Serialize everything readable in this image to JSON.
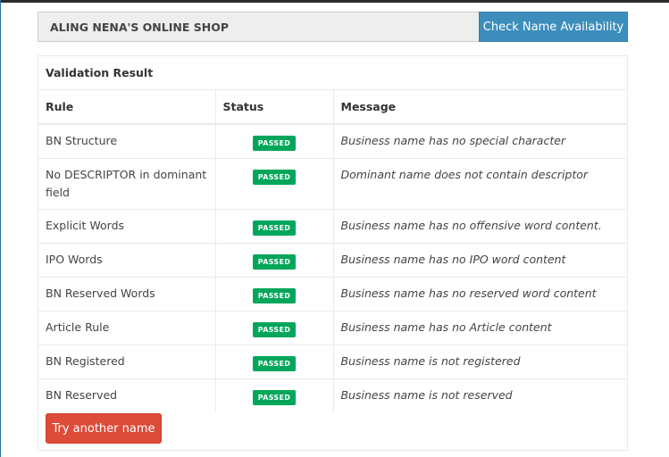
{
  "search": {
    "business_name": "ALING NENA'S ONLINE SHOP",
    "check_button": "Check Name Availability"
  },
  "result": {
    "title": "Validation Result",
    "columns": [
      "Rule",
      "Status",
      "Message"
    ],
    "rows": [
      {
        "rule": "BN Structure",
        "status": "PASSED",
        "message": "Business name has no special character"
      },
      {
        "rule": "No DESCRIPTOR in dominant field",
        "status": "PASSED",
        "message": "Dominant name does not contain descriptor"
      },
      {
        "rule": "Explicit Words",
        "status": "PASSED",
        "message": "Business name has no offensive word content."
      },
      {
        "rule": "IPO Words",
        "status": "PASSED",
        "message": "Business name has no IPO word content"
      },
      {
        "rule": "BN Reserved Words",
        "status": "PASSED",
        "message": "Business name has no reserved word content"
      },
      {
        "rule": "Article Rule",
        "status": "PASSED",
        "message": "Business name has no Article content"
      },
      {
        "rule": "BN Registered",
        "status": "PASSED",
        "message": "Business name is not registered"
      },
      {
        "rule": "BN Reserved",
        "status": "PASSED",
        "message": "Business name is not reserved"
      }
    ],
    "retry_button": "Try another name"
  },
  "colors": {
    "primary": "#3c8dbc",
    "success": "#00a65a",
    "danger": "#dd4b39"
  }
}
